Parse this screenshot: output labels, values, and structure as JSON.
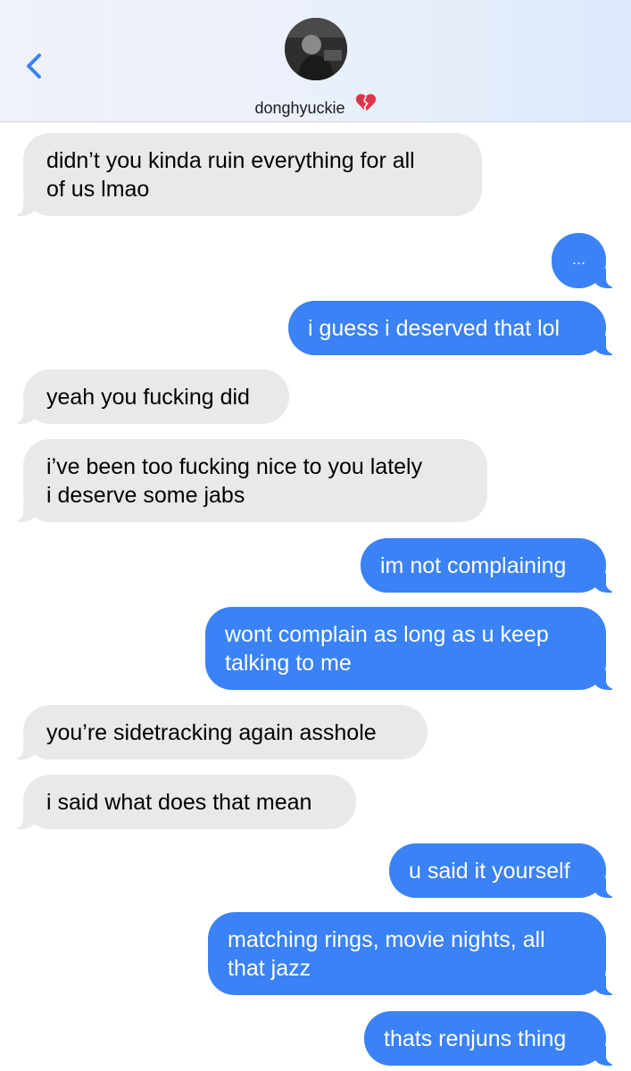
{
  "header": {
    "contact_name": "donghyuckie",
    "name_emoji": "broken-heart-icon",
    "accent_color": "#3a82f6"
  },
  "messages": [
    {
      "direction": "incoming",
      "text": "didn’t you kinda ruin everything for all\nof us lmao"
    },
    {
      "direction": "outgoing",
      "text": "..."
    },
    {
      "direction": "outgoing",
      "text": "i guess i deserved that lol"
    },
    {
      "direction": "incoming",
      "text": "yeah you fucking did"
    },
    {
      "direction": "incoming",
      "text": "i’ve been too fucking nice to you lately\ni deserve some jabs"
    },
    {
      "direction": "outgoing",
      "text": "im not complaining"
    },
    {
      "direction": "outgoing",
      "text": "wont complain as long as u keep\ntalking to me"
    },
    {
      "direction": "incoming",
      "text": "you’re sidetracking again asshole"
    },
    {
      "direction": "incoming",
      "text": "i said what does that mean"
    },
    {
      "direction": "outgoing",
      "text": "u said it yourself"
    },
    {
      "direction": "outgoing",
      "text": "matching rings, movie nights, all\nthat jazz"
    },
    {
      "direction": "outgoing",
      "text": "thats renjuns thing"
    }
  ]
}
